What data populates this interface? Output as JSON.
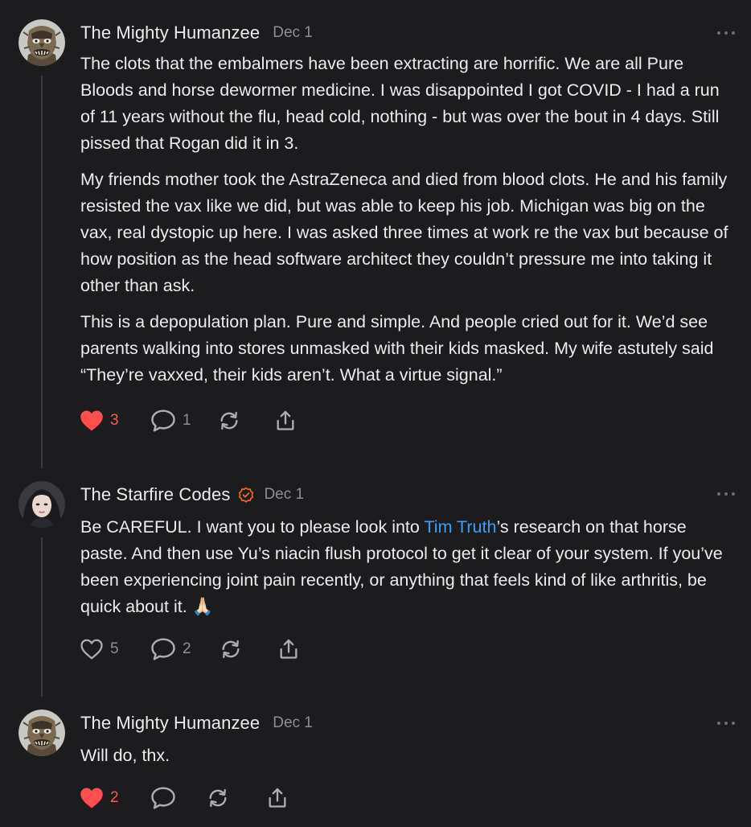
{
  "colors": {
    "background": "#1c1c1e",
    "text": "#ececee",
    "muted": "#8e8e93",
    "link": "#3d9df5",
    "like_active": "#ff4e4e",
    "verified": "#ff6719"
  },
  "comments": [
    {
      "author": "The Mighty Humanzee",
      "date": "Dec 1",
      "avatar_icon": "masked-figure-avatar",
      "paragraphs": [
        "The clots that the embalmers have been extracting are horrific. We are all Pure Bloods and horse dewormer medicine. I was disappointed I got COVID - I had a run of 11 years without the flu, head cold, nothing - but was over the bout in 4 days. Still pissed that Rogan did it in 3.",
        "My friends mother took the AstraZeneca and died from blood clots. He and his family resisted the vax like we did, but was able to keep his job. Michigan was big on the vax, real dystopic up here. I was asked three times at work re the vax but because of how position as the head software architect they couldn’t pressure me into taking it other than ask.",
        "This is a depopulation plan. Pure and simple. And people cried out for it. We’d see parents walking into stores unmasked with their kids masked. My wife astutely said “They’re vaxxed, their kids aren’t. What a virtue signal.”"
      ],
      "likes": "3",
      "liked": true,
      "replies": "1"
    },
    {
      "author": "The Starfire Codes",
      "date": "Dec 1",
      "verified": true,
      "avatar_icon": "woman-portrait-avatar",
      "text_before_link": "Be CAREFUL. I want you to please look into ",
      "link_text": "Tim Truth",
      "text_after_link": "’s research on that horse paste. And then use Yu’s niacin flush protocol to get it clear of your system. If you’ve been experiencing joint pain recently, or anything that feels kind of like arthritis, be quick about it. 🙏🏻",
      "likes": "5",
      "liked": false,
      "replies": "2"
    },
    {
      "author": "The Mighty Humanzee",
      "date": "Dec 1",
      "avatar_icon": "masked-figure-avatar",
      "text": "Will do, thx.",
      "likes": "2",
      "liked": true
    }
  ]
}
